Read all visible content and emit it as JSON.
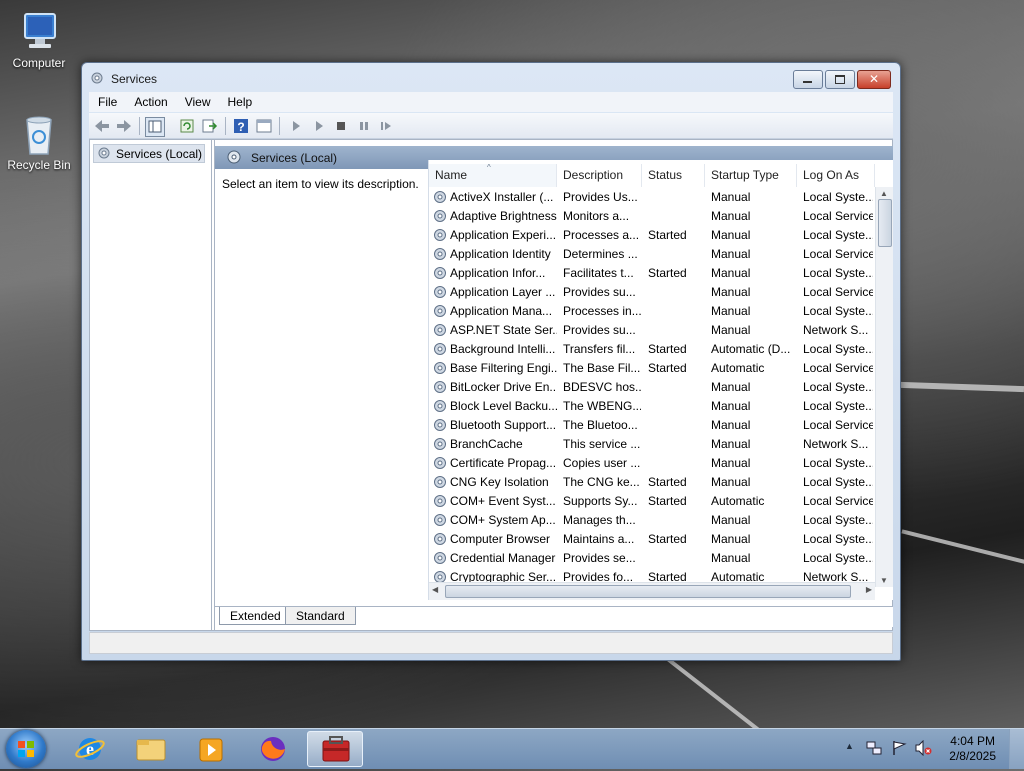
{
  "desktop": {
    "icons": [
      {
        "label": "Computer",
        "icon": "computer-icon"
      },
      {
        "label": "Recycle Bin",
        "icon": "recycle-bin-icon"
      }
    ]
  },
  "window": {
    "title": "Services",
    "menu": [
      "File",
      "Action",
      "View",
      "Help"
    ],
    "tree": {
      "root_label": "Services (Local)"
    },
    "header_label": "Services (Local)",
    "description_hint": "Select an item to view its description.",
    "columns": [
      "Name",
      "Description",
      "Status",
      "Startup Type",
      "Log On As"
    ],
    "rows": [
      [
        "ActiveX Installer (...",
        "Provides Us...",
        "",
        "Manual",
        "Local Syste..."
      ],
      [
        "Adaptive Brightness",
        "Monitors a...",
        "",
        "Manual",
        "Local Service"
      ],
      [
        "Application Experi...",
        "Processes a...",
        "Started",
        "Manual",
        "Local Syste..."
      ],
      [
        "Application Identity",
        "Determines ...",
        "",
        "Manual",
        "Local Service"
      ],
      [
        "Application Infor...",
        "Facilitates t...",
        "Started",
        "Manual",
        "Local Syste..."
      ],
      [
        "Application Layer ...",
        "Provides su...",
        "",
        "Manual",
        "Local Service"
      ],
      [
        "Application Mana...",
        "Processes in...",
        "",
        "Manual",
        "Local Syste..."
      ],
      [
        "ASP.NET State Ser...",
        "Provides su...",
        "",
        "Manual",
        "Network S..."
      ],
      [
        "Background Intelli...",
        "Transfers fil...",
        "Started",
        "Automatic (D...",
        "Local Syste..."
      ],
      [
        "Base Filtering Engi...",
        "The Base Fil...",
        "Started",
        "Automatic",
        "Local Service"
      ],
      [
        "BitLocker Drive En...",
        "BDESVC hos...",
        "",
        "Manual",
        "Local Syste..."
      ],
      [
        "Block Level Backu...",
        "The WBENG...",
        "",
        "Manual",
        "Local Syste..."
      ],
      [
        "Bluetooth Support...",
        "The Bluetoo...",
        "",
        "Manual",
        "Local Service"
      ],
      [
        "BranchCache",
        "This service ...",
        "",
        "Manual",
        "Network S..."
      ],
      [
        "Certificate Propag...",
        "Copies user ...",
        "",
        "Manual",
        "Local Syste..."
      ],
      [
        "CNG Key Isolation",
        "The CNG ke...",
        "Started",
        "Manual",
        "Local Syste..."
      ],
      [
        "COM+ Event Syst...",
        "Supports Sy...",
        "Started",
        "Automatic",
        "Local Service"
      ],
      [
        "COM+ System Ap...",
        "Manages th...",
        "",
        "Manual",
        "Local Syste..."
      ],
      [
        "Computer Browser",
        "Maintains a...",
        "Started",
        "Manual",
        "Local Syste..."
      ],
      [
        "Credential Manager",
        "Provides se...",
        "",
        "Manual",
        "Local Syste..."
      ],
      [
        "Cryptographic Ser...",
        "Provides fo...",
        "Started",
        "Automatic",
        "Network S..."
      ]
    ],
    "tabs": [
      "Extended",
      "Standard"
    ]
  },
  "taskbar": {
    "apps": [
      "internet-explorer-icon",
      "file-explorer-icon",
      "media-player-icon",
      "firefox-icon",
      "toolbox-icon"
    ],
    "clock": {
      "time": "4:04 PM",
      "date": "2/8/2025"
    }
  }
}
